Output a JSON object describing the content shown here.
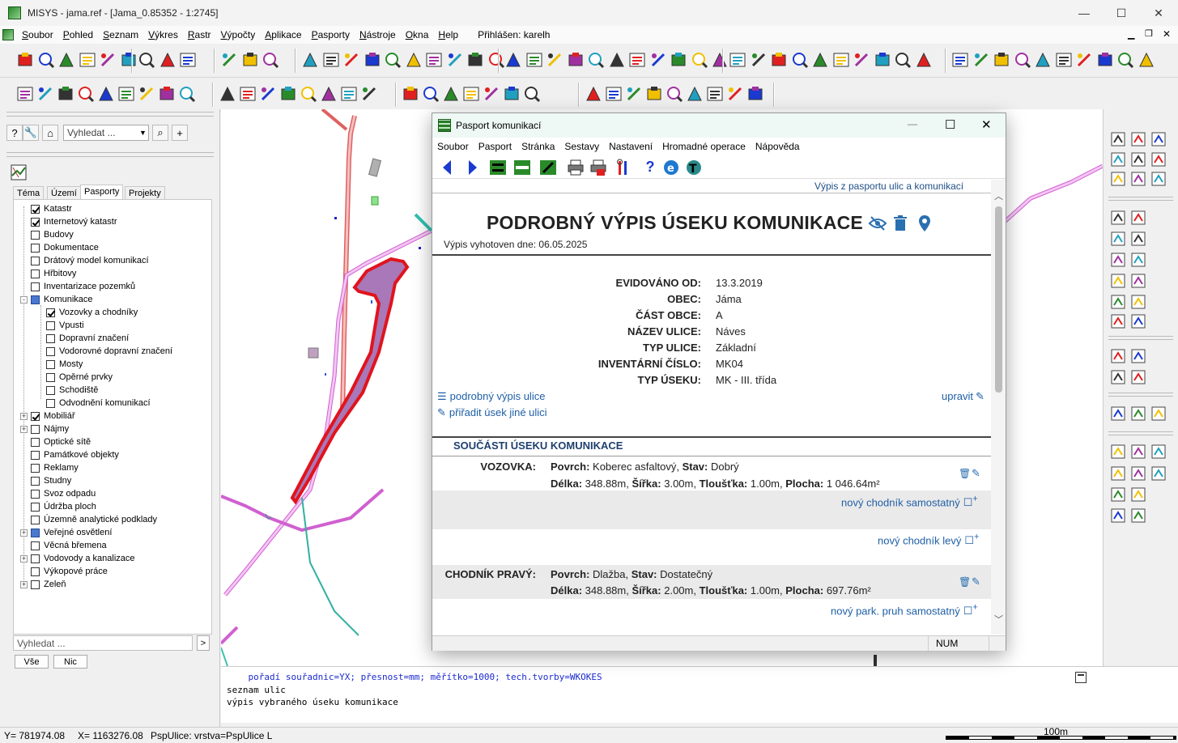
{
  "app": {
    "title": "MISYS - jama.ref - [Jama_0.85352 - 1:2745]",
    "logged_in": "Přihlášen: karelh"
  },
  "menu": [
    "Soubor",
    "Pohled",
    "Seznam",
    "Výkres",
    "Rastr",
    "Výpočty",
    "Aplikace",
    "Pasporty",
    "Nástroje",
    "Okna",
    "Help"
  ],
  "left": {
    "search_placeholder": "Vyhledat ...",
    "tabs": [
      "Téma",
      "Území",
      "Pasporty",
      "Projekty"
    ],
    "tree": [
      {
        "label": "Katastr",
        "checked": true,
        "level": 0,
        "expander": ""
      },
      {
        "label": "Internetový katastr",
        "checked": true,
        "level": 0,
        "expander": ""
      },
      {
        "label": "Budovy",
        "checked": false,
        "level": 0,
        "expander": ""
      },
      {
        "label": "Dokumentace",
        "checked": false,
        "level": 0,
        "expander": ""
      },
      {
        "label": "Drátový model komunikací",
        "checked": false,
        "level": 0,
        "expander": ""
      },
      {
        "label": "Hřbitovy",
        "checked": false,
        "level": 0,
        "expander": ""
      },
      {
        "label": "Inventarizace pozemků",
        "checked": false,
        "level": 0,
        "expander": ""
      },
      {
        "label": "Komunikace",
        "checked": false,
        "level": 0,
        "expander": "-",
        "partial": true
      },
      {
        "label": "Vozovky a chodníky",
        "checked": true,
        "level": 1,
        "expander": ""
      },
      {
        "label": "Vpusti",
        "checked": false,
        "level": 1,
        "expander": ""
      },
      {
        "label": "Dopravní značení",
        "checked": false,
        "level": 1,
        "expander": ""
      },
      {
        "label": "Vodorovné dopravní značení",
        "checked": false,
        "level": 1,
        "expander": ""
      },
      {
        "label": "Mosty",
        "checked": false,
        "level": 1,
        "expander": ""
      },
      {
        "label": "Opěrné prvky",
        "checked": false,
        "level": 1,
        "expander": ""
      },
      {
        "label": "Schodiště",
        "checked": false,
        "level": 1,
        "expander": ""
      },
      {
        "label": "Odvodnění komunikací",
        "checked": false,
        "level": 1,
        "expander": ""
      },
      {
        "label": "Mobiliář",
        "checked": true,
        "level": 0,
        "expander": "+"
      },
      {
        "label": "Nájmy",
        "checked": false,
        "level": 0,
        "expander": "+"
      },
      {
        "label": "Optické sítě",
        "checked": false,
        "level": 0,
        "expander": ""
      },
      {
        "label": "Památkové objekty",
        "checked": false,
        "level": 0,
        "expander": ""
      },
      {
        "label": "Reklamy",
        "checked": false,
        "level": 0,
        "expander": ""
      },
      {
        "label": "Studny",
        "checked": false,
        "level": 0,
        "expander": ""
      },
      {
        "label": "Svoz odpadu",
        "checked": false,
        "level": 0,
        "expander": ""
      },
      {
        "label": "Údržba ploch",
        "checked": false,
        "level": 0,
        "expander": ""
      },
      {
        "label": "Územně analytické podklady",
        "checked": false,
        "level": 0,
        "expander": ""
      },
      {
        "label": "Veřejné osvětlení",
        "checked": false,
        "level": 0,
        "expander": "+",
        "partial": true
      },
      {
        "label": "Věcná břemena",
        "checked": false,
        "level": 0,
        "expander": ""
      },
      {
        "label": "Vodovody a kanalizace",
        "checked": false,
        "level": 0,
        "expander": "+"
      },
      {
        "label": "Výkopové práce",
        "checked": false,
        "level": 0,
        "expander": ""
      },
      {
        "label": "Zeleň",
        "checked": false,
        "level": 0,
        "expander": "+"
      }
    ],
    "bottom_search_placeholder": "Vyhledat ...",
    "btn_all": "Vše",
    "btn_none": "Nic"
  },
  "dialog": {
    "title": "Pasport komunikací",
    "menu": [
      "Soubor",
      "Pasport",
      "Stránka",
      "Sestavy",
      "Nastavení",
      "Hromadné operace",
      "Nápověda"
    ],
    "header_link": "Výpis z pasportu ulic a komunikací",
    "heading": "PODROBNÝ VÝPIS ÚSEKU KOMUNIKACE",
    "generated": "Výpis vyhotoven dne: 06.05.2025",
    "fields": [
      {
        "k": "EVIDOVÁNO OD:",
        "v": "13.3.2019"
      },
      {
        "k": "OBEC:",
        "v": "Jáma"
      },
      {
        "k": "ČÁST OBCE:",
        "v": "A"
      },
      {
        "k": "NÁZEV ULICE:",
        "v": "Náves"
      },
      {
        "k": "TYP ULICE:",
        "v": "Základní"
      },
      {
        "k": "INVENTÁRNÍ ČÍSLO:",
        "v": "MK04"
      },
      {
        "k": "TYP ÚSEKU:",
        "v": "MK - III. třída"
      }
    ],
    "link_detail": "podrobný výpis ulice",
    "link_assign": "přiřadit úsek jiné ulici",
    "link_edit": "upravit",
    "section": "SOUČÁSTI ÚSEKU KOMUNIKACE",
    "vozovka": {
      "label": "VOZOVKA:",
      "l1_a": "Povrch:",
      "l1_b": " Koberec asfaltový, ",
      "l1_c": "Stav:",
      "l1_d": " Dobrý",
      "l2_a": "Délka:",
      "l2_b": " 348.88m, ",
      "l2_c": "Šířka:",
      "l2_d": " 3.00m, ",
      "l2_e": "Tloušťka:",
      "l2_f": " 1.00m, ",
      "l2_g": "Plocha:",
      "l2_h": " 1 046.64m²"
    },
    "new_sidewalk_ind": "nový chodník samostatný",
    "new_sidewalk_left": "nový chodník levý",
    "chodnik": {
      "label": "CHODNÍK PRAVÝ:",
      "l1_a": "Povrch:",
      "l1_b": " Dlažba, ",
      "l1_c": "Stav:",
      "l1_d": " Dostatečný",
      "l2_a": "Délka:",
      "l2_b": " 348.88m, ",
      "l2_c": "Šířka:",
      "l2_d": " 2.00m, ",
      "l2_e": "Tloušťka:",
      "l2_f": " 1.00m, ",
      "l2_g": "Plocha:",
      "l2_h": " 697.76m²"
    },
    "new_parking": "nový park. pruh samostatný",
    "status": "NUM"
  },
  "cmd": {
    "l1": "    pořadí souřadnic=YX; přesnost=mm; měřítko=1000; tech.tvorby=WKOKES",
    "l2": "seznam ulic",
    "l3": "výpis vybraného úseku komunikace"
  },
  "status": {
    "y": "Y=   781974.08",
    "x": "X=  1163276.08",
    "info": "PspUlice: vrstva=PspUlice L",
    "scale": "100m"
  },
  "colors": {
    "accent": "#1f5fa6",
    "road_highlight": "#e0141e",
    "road_fill": "#a878b8",
    "magenta_road": "#e060e0",
    "teal_road": "#30c0b0"
  }
}
